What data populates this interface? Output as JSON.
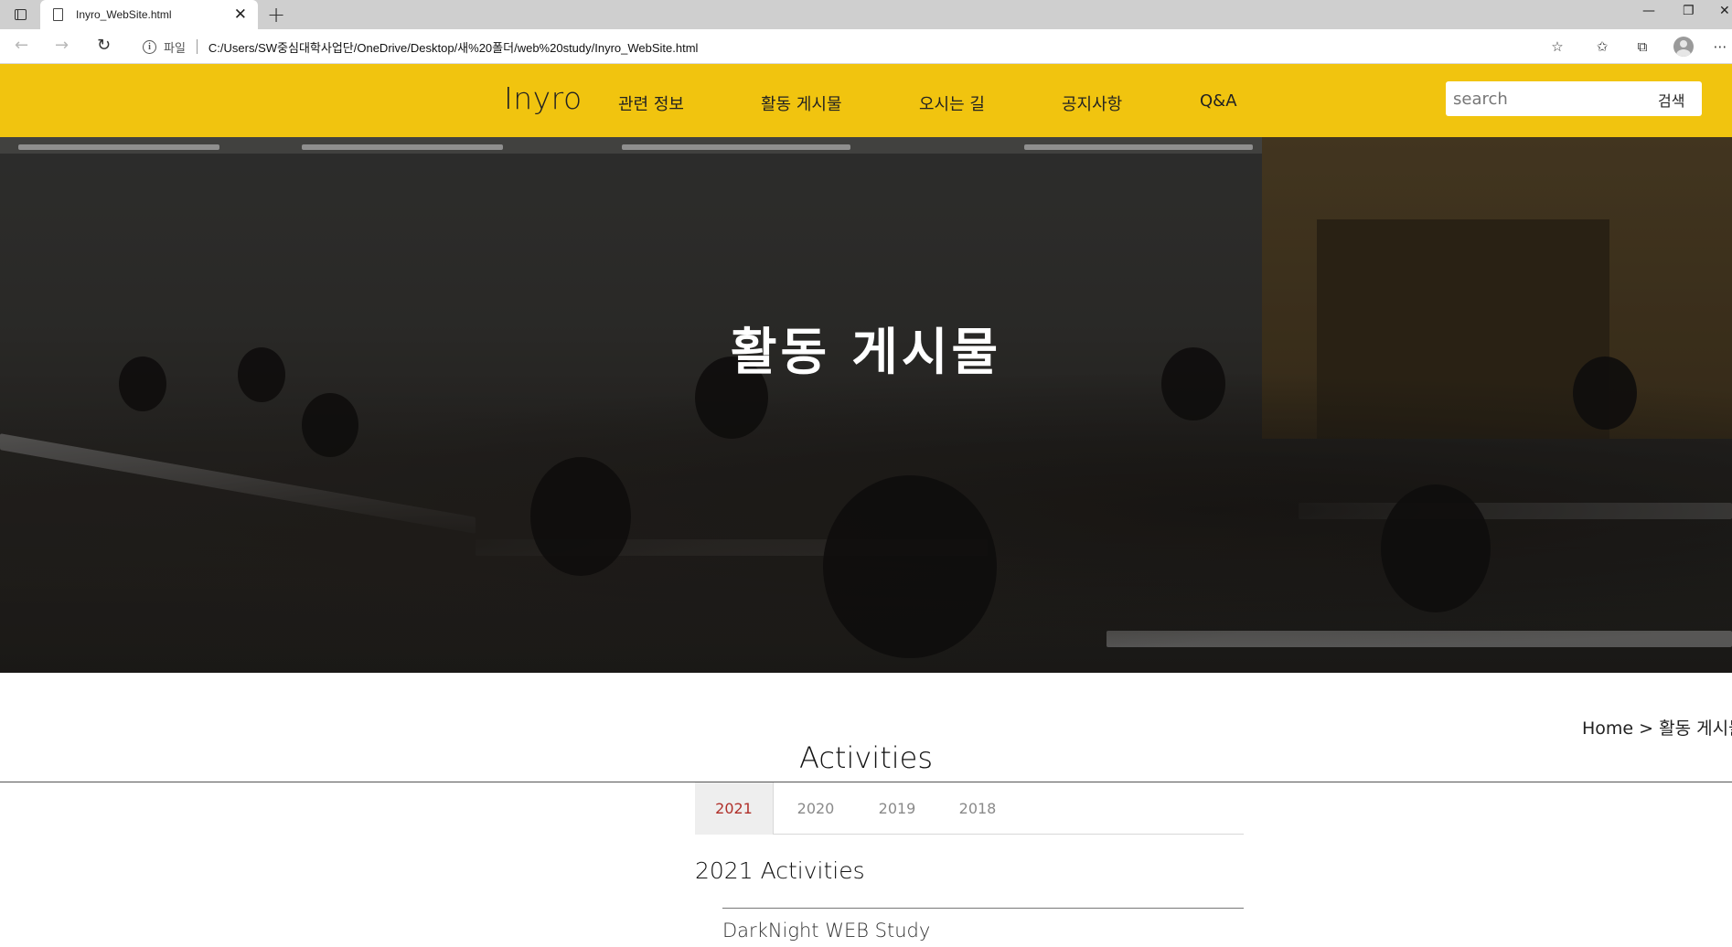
{
  "browser": {
    "tab_title": "Inyro_WebSite.html",
    "tab_close": "✕",
    "new_tab": "+",
    "url_prefix_label": "파일",
    "url": "C:/Users/SW중심대학사업단/OneDrive/Desktop/새%20폴더/web%20study/Inyro_WebSite.html",
    "window_controls": [
      "—",
      "❐",
      "✕"
    ]
  },
  "header": {
    "logo": "Inyro",
    "menu": [
      "관련 정보",
      "활동 게시물",
      "오시는 길",
      "공지사항",
      "Q&A"
    ],
    "search_placeholder": "search",
    "search_button": "검색",
    "background_color": "#f1c40f"
  },
  "hero": {
    "title": "활동 게시물"
  },
  "content": {
    "breadcrumb": "Home > 활동 게시물",
    "section_title": "Activities",
    "year_tabs": [
      "2021",
      "2020",
      "2019",
      "2018"
    ],
    "active_year": "2021",
    "year_heading": "2021 Activities",
    "activities": [
      "DarkNight WEB Study"
    ],
    "active_tab_color": "#b0302a"
  }
}
